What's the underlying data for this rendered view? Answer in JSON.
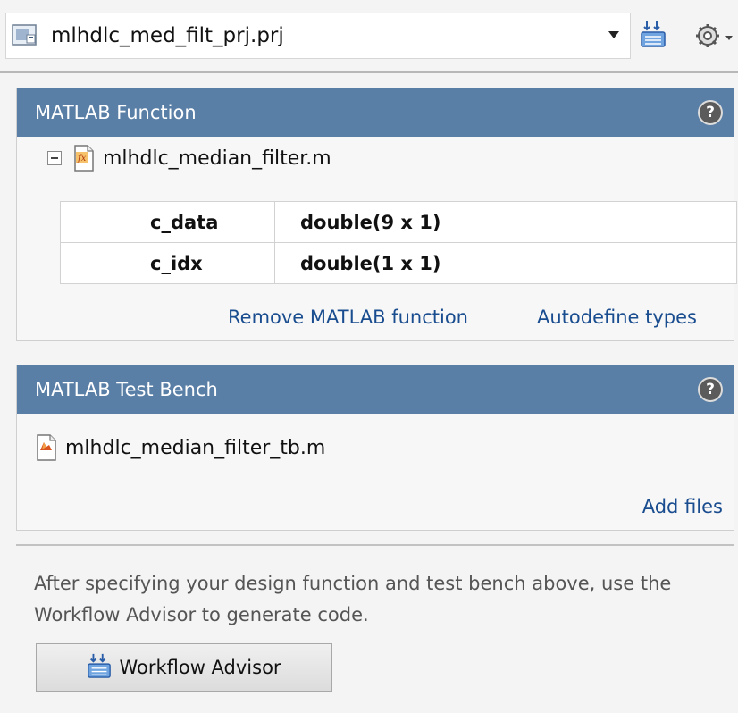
{
  "project": {
    "file_name": "mlhdlc_med_filt_prj.prj",
    "icon": "project-file-icon"
  },
  "toolbar": {
    "workflow_icon": "workflow-advisor-icon",
    "settings_icon": "gear-icon"
  },
  "matlab_function_panel": {
    "title": "MATLAB Function",
    "help_icon": "help-icon",
    "file_name": "mlhdlc_median_filter.m",
    "inputs": [
      {
        "name": "c_data",
        "type": "double(9 x 1)"
      },
      {
        "name": "c_idx",
        "type": "double(1 x 1)"
      }
    ],
    "remove_link": "Remove MATLAB function",
    "autodefine_link": "Autodefine types"
  },
  "test_bench_panel": {
    "title": "MATLAB Test Bench",
    "help_icon": "help-icon",
    "file_name": "mlhdlc_median_filter_tb.m",
    "add_files_link": "Add files"
  },
  "footer": {
    "hint": "After specifying your design function and test bench above, use the Workflow Advisor to generate code.",
    "workflow_button": "Workflow Advisor"
  },
  "colors": {
    "panel_header": "#5a7fa6",
    "link": "#1a4d8f"
  }
}
